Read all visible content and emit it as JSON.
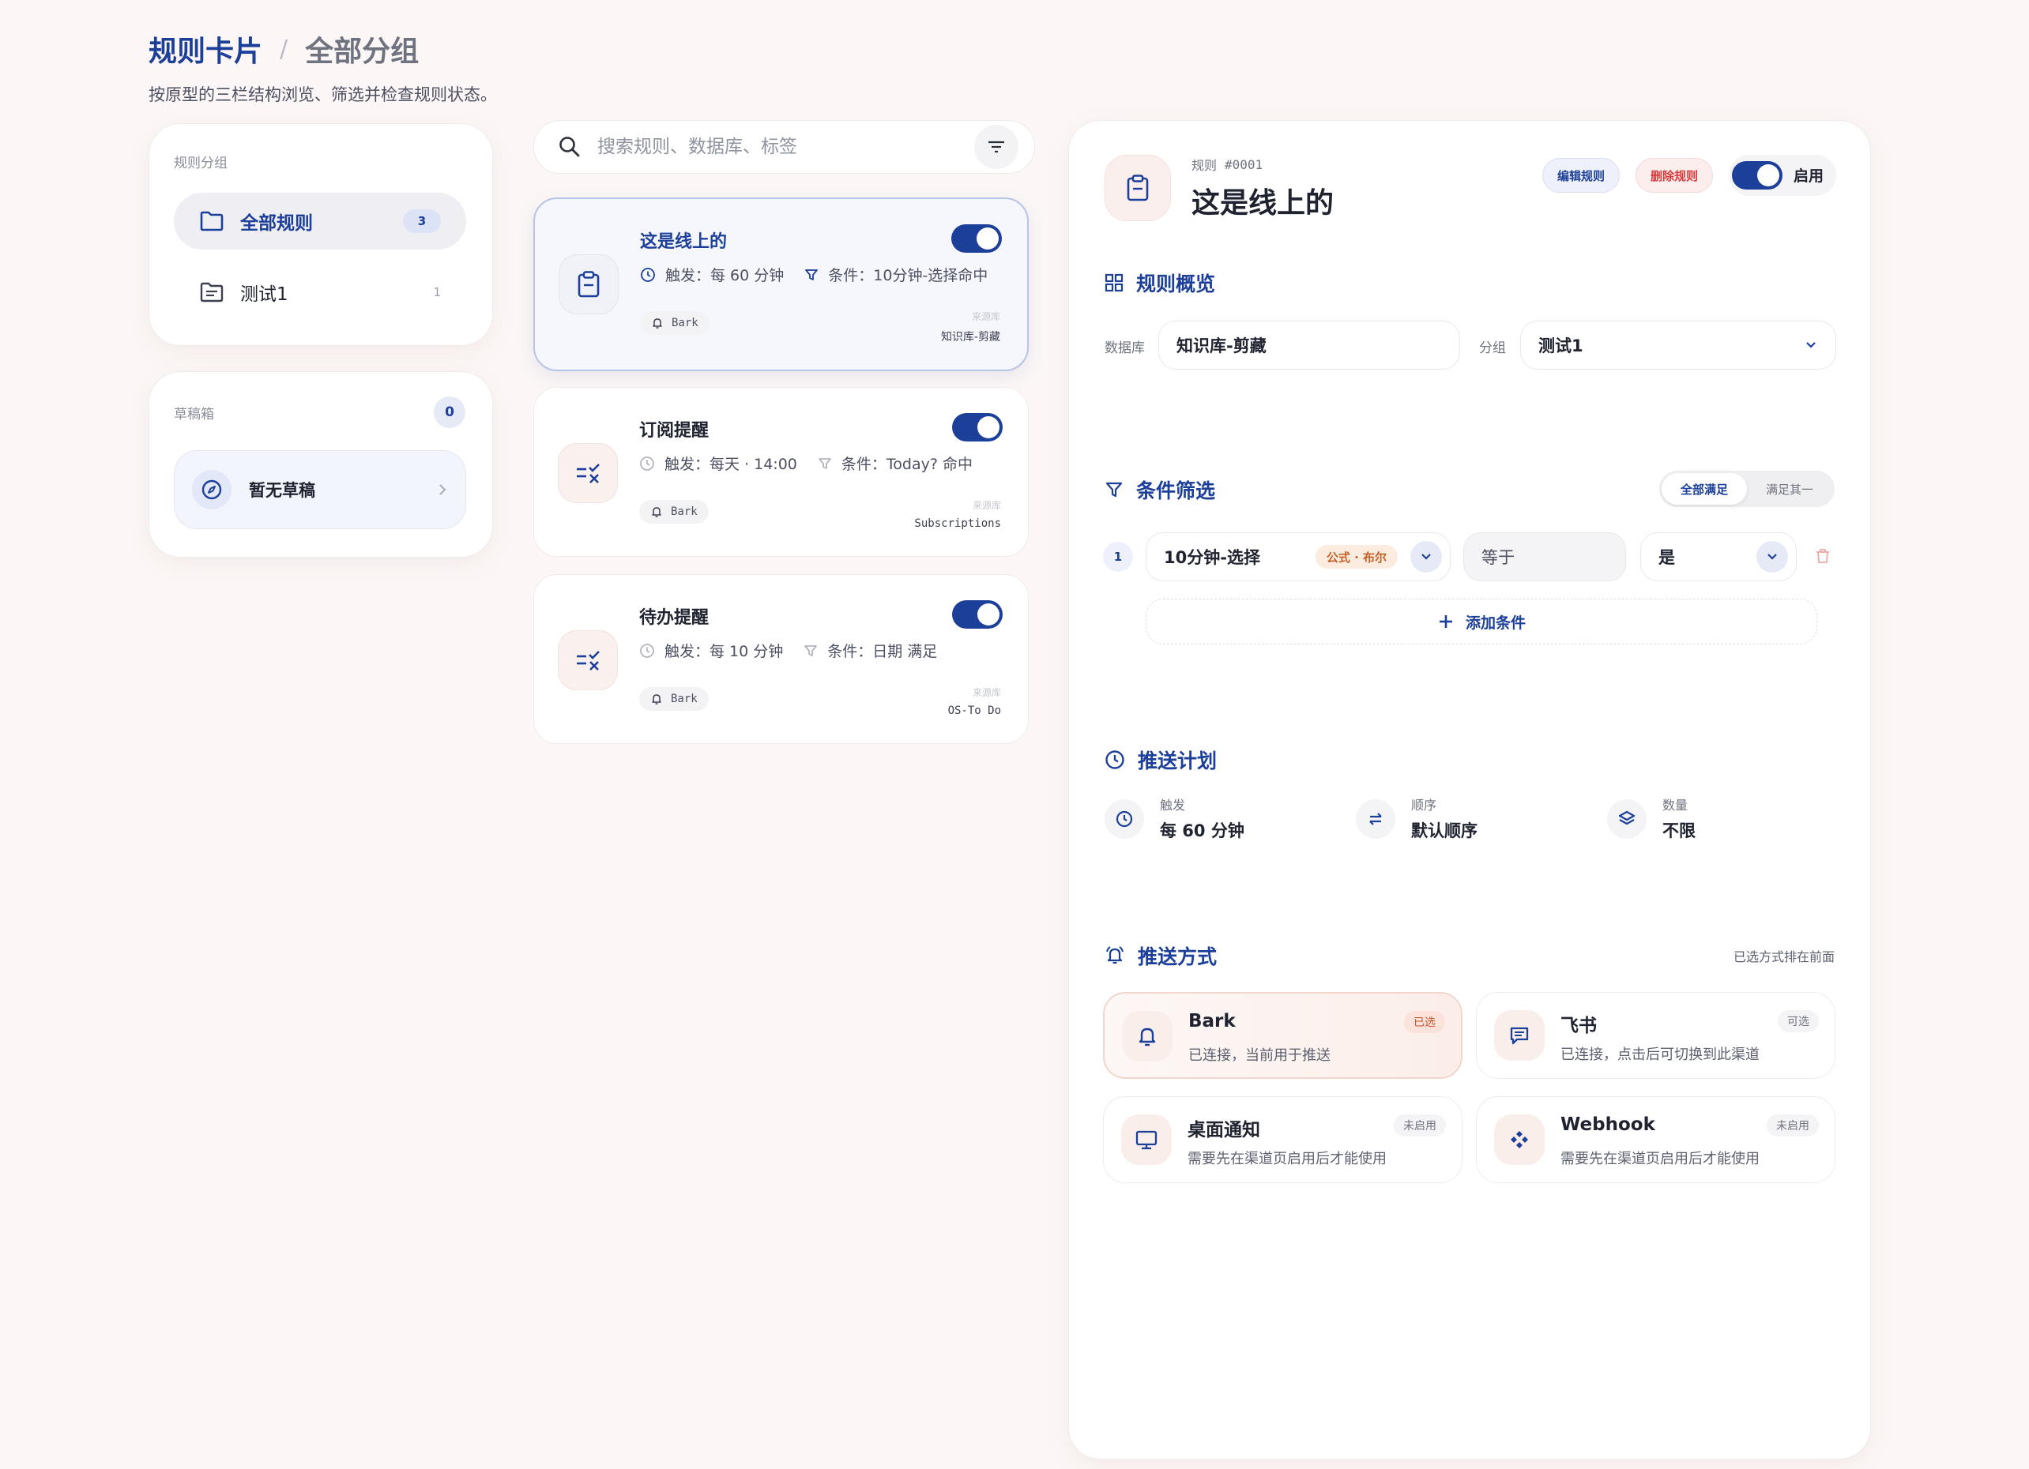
{
  "header": {
    "title": "规则卡片",
    "separator": "/",
    "subtitle_crumb": "全部分组",
    "description": "按原型的三栏结构浏览、筛选并检查规则状态。"
  },
  "groups": {
    "label": "规则分组",
    "items": [
      {
        "label": "全部规则",
        "count": "3",
        "icon": "folder-icon",
        "active": true
      },
      {
        "label": "测试1",
        "count": "1",
        "icon": "folder-list-icon",
        "active": false
      }
    ]
  },
  "drafts": {
    "label": "草稿箱",
    "count": "0",
    "empty_label": "暂无草稿"
  },
  "search": {
    "placeholder": "搜索规则、数据库、标签"
  },
  "rules": [
    {
      "name": "这是线上的",
      "trigger": "触发：每 60 分钟",
      "condition": "条件：10分钟-选择命中",
      "tag": "Bark",
      "source_label": "来源库",
      "source": "知识库-剪藏",
      "icon": "clipboard-icon",
      "enabled": true,
      "selected": true
    },
    {
      "name": "订阅提醒",
      "trigger": "触发：每天 · 14:00",
      "condition": "条件：Today? 命中",
      "tag": "Bark",
      "source_label": "来源库",
      "source": "Subscriptions",
      "icon": "checklist-icon",
      "enabled": true,
      "selected": false
    },
    {
      "name": "待办提醒",
      "trigger": "触发：每 10 分钟",
      "condition": "条件：日期 满足",
      "tag": "Bark",
      "source_label": "来源库",
      "source": "OS-To Do",
      "icon": "checklist-icon",
      "enabled": true,
      "selected": false
    }
  ],
  "detail": {
    "rule_label": "规则",
    "rule_id": "#0001",
    "title": "这是线上的",
    "edit_label": "编辑规则",
    "delete_label": "删除规则",
    "enable_label": "启用",
    "overview": {
      "title": "规则概览",
      "db_label": "数据库",
      "db_value": "知识库-剪藏",
      "group_label": "分组",
      "group_value": "测试1"
    },
    "conditions": {
      "title": "条件筛选",
      "mode_all": "全部满足",
      "mode_any": "满足其一",
      "rows": [
        {
          "index": "1",
          "field": "10分钟-选择",
          "field_type": "公式 · 布尔",
          "operator": "等于",
          "value": "是"
        }
      ],
      "add_label": "添加条件"
    },
    "schedule": {
      "title": "推送计划",
      "items": [
        {
          "label": "触发",
          "value": "每 60 分钟",
          "icon": "clock-icon"
        },
        {
          "label": "顺序",
          "value": "默认顺序",
          "icon": "swap-icon"
        },
        {
          "label": "数量",
          "value": "不限",
          "icon": "layers-icon"
        }
      ]
    },
    "channels": {
      "title": "推送方式",
      "hint": "已选方式排在前面",
      "items": [
        {
          "name": "Bark",
          "desc": "已连接，当前用于推送",
          "status": "已选",
          "icon": "bell-icon"
        },
        {
          "name": "飞书",
          "desc": "已连接，点击后可切换到此渠道",
          "status": "可选",
          "icon": "message-icon"
        },
        {
          "name": "桌面通知",
          "desc": "需要先在渠道页启用后才能使用",
          "status": "未启用",
          "icon": "monitor-icon"
        },
        {
          "name": "Webhook",
          "desc": "需要先在渠道页启用后才能使用",
          "status": "未启用",
          "icon": "webhook-icon"
        }
      ]
    }
  },
  "colors": {
    "accent": "#1c3f9a",
    "danger": "#d93a3a",
    "background": "#fcf7f6"
  }
}
